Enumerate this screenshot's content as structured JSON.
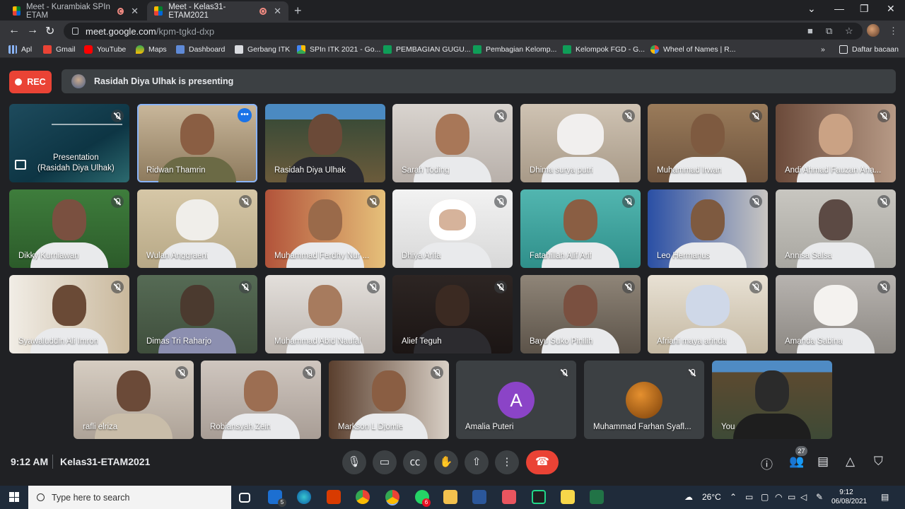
{
  "browser": {
    "tabs": [
      {
        "title": "Meet - Kurambiak SPIn ETAM"
      },
      {
        "title": "Meet - Kelas31-ETAM2021"
      }
    ],
    "url_host": "meet.google.com",
    "url_path": "/kpm-tgkd-dxp",
    "bookmarks": [
      {
        "label": "Apl"
      },
      {
        "label": "Gmail"
      },
      {
        "label": "YouTube"
      },
      {
        "label": "Maps"
      },
      {
        "label": "Dashboard"
      },
      {
        "label": "Gerbang ITK"
      },
      {
        "label": "SPIn ITK 2021 - Go..."
      },
      {
        "label": "PEMBAGIAN GUGU..."
      },
      {
        "label": "Pembagian Kelomp..."
      },
      {
        "label": "Kelompok FGD - G..."
      },
      {
        "label": "Wheel of Names | R..."
      }
    ],
    "reading_list": "Daftar bacaan"
  },
  "meet": {
    "rec_label": "REC",
    "presenting_text": "Rasidah Diya Ulhak is presenting",
    "presentation_tile": {
      "line1": "Presentation",
      "line2": "(Rasidah Diya Ulhak)"
    },
    "participants": [
      {
        "name": "Ridwan Thamrin"
      },
      {
        "name": "Rasidah Diya Ulhak"
      },
      {
        "name": "Sarah Toding"
      },
      {
        "name": "Dhima surya putri"
      },
      {
        "name": "Muhammad Irwan"
      },
      {
        "name": "Andi Ahmad Fauzan Ana..."
      },
      {
        "name": "Dikky Kurniawan"
      },
      {
        "name": "Wulan Anggraeni"
      },
      {
        "name": "Muhammad Ferdhy Nur ..."
      },
      {
        "name": "Dhiya Arifa"
      },
      {
        "name": "Fatahillah Alif Arif"
      },
      {
        "name": "Leo Hermanus"
      },
      {
        "name": "Annisa Salsa"
      },
      {
        "name": "Syawaluddin Ali Imron"
      },
      {
        "name": "Dimas Tri Raharjo"
      },
      {
        "name": "Muhammad Abid Naufal"
      },
      {
        "name": "Alief Teguh"
      },
      {
        "name": "Bayu Suko Pinilih"
      },
      {
        "name": "Afriani maya arinda"
      },
      {
        "name": "Amanda Sabina"
      },
      {
        "name": "rafli elriza"
      },
      {
        "name": "Robiansyah Zein"
      },
      {
        "name": "Markson L Djomie"
      },
      {
        "name": "Amalia Puteri",
        "avatar_letter": "A"
      },
      {
        "name": "Muhammad Farhan Syafl..."
      },
      {
        "name": "You"
      }
    ],
    "clock": "9:12 AM",
    "meeting_code": "Kelas31-ETAM2021",
    "participant_count": "27"
  },
  "taskbar": {
    "search_placeholder": "Type here to search",
    "mail_badge": "5",
    "whatsapp_badge": "6",
    "temperature": "26°C",
    "time": "9:12",
    "date": "06/08/2021"
  }
}
